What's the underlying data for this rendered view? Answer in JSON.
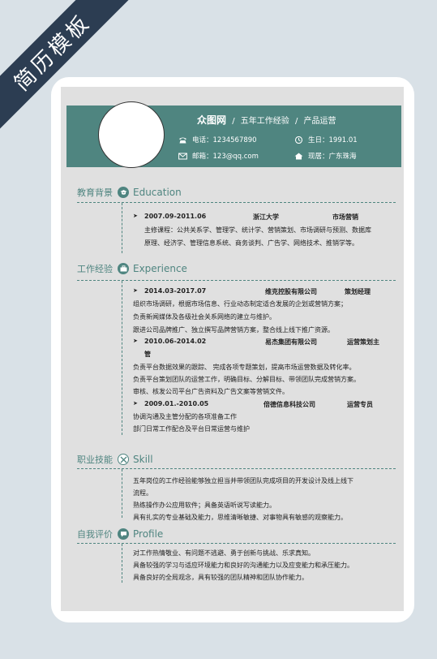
{
  "ribbon_text": "简历模板",
  "colors": {
    "accent": "#4f8580",
    "ribbon": "#2c3d52",
    "background": "#d9e1e7",
    "paper": "#e0e0e0"
  },
  "header": {
    "name": "众图网",
    "sep": "/",
    "experience": "五年工作经验",
    "position": "产品运营",
    "phone": "电话：1234567890",
    "birth": "生日：1991.01",
    "email": "邮箱：123@qq.com",
    "residence": "现居：广东珠海"
  },
  "sections": {
    "education": {
      "cn": "教育背景",
      "en": "Education"
    },
    "experience": {
      "cn": "工作经验",
      "en": "Experience"
    },
    "skill": {
      "cn": "职业技能",
      "en": "Skill"
    },
    "profile": {
      "cn": "自我评价",
      "en": "Profile"
    }
  },
  "education": {
    "date": "2007.09-2011.06",
    "school": "浙江大学",
    "major": "市场营销",
    "courses_1": "主修课程：公共关系学、管理学、统计学、营销策划、市场调研与预测、数据库",
    "courses_2": "原理、经济学、管理信息系统、商务谈判、广告学、网络技术、推销学等。"
  },
  "jobs": [
    {
      "date": "2014.03-2017.07",
      "company": "维克控股有限公司",
      "title": "策划经理",
      "lines": [
        "组织市场调研，根据市场信息、行业动态制定适合发展的企划或营销方案；",
        "负责新闻媒体及各级社会关系网络的建立与维护。",
        "跟进公司品牌推广、独立撰写品牌营销方案，整合线上线下推广资源。"
      ]
    },
    {
      "date": "2010.06-2014.02",
      "company": "易杰集团有限公司",
      "title": "运营策划主",
      "title_2": "管",
      "lines": [
        "负责平台数据效果的跟踪、 完成各项专题策划，提高市场运营数据及转化率。",
        "负责平台策划团队的运营工作，明确目标、分解目标、带领团队完成营销方案。",
        "审核、核发公司平台广告资料及广告文案等营销文件。"
      ]
    },
    {
      "date": "2009.01.-2010.05",
      "company": "倍德信息科技公司",
      "title": "运营专员",
      "lines": [
        "协调沟通及主管分配的各项准备工作",
        "部门日常工作配合及平台日常运营与维护"
      ]
    }
  ],
  "skills": [
    "五年岗位的工作经验能够独立担当并带领团队完成项目的开发设计及线上线下",
    "流程。",
    "熟练操作办公应用软件；具备英语听说写读能力。",
    "具有扎实的专业基础及能力，思维清晰敏捷、对事物具有敏感的观察能力。"
  ],
  "profile": [
    "对工作热情敬业、有问题不逃避、勇于创新与挑战、乐求真知。",
    "具备较强的学习与适应环境能力和良好的沟通能力以及应变能力和承压能力。",
    "具备良好的全局观念，具有较强的团队精神和团队协作能力。"
  ]
}
